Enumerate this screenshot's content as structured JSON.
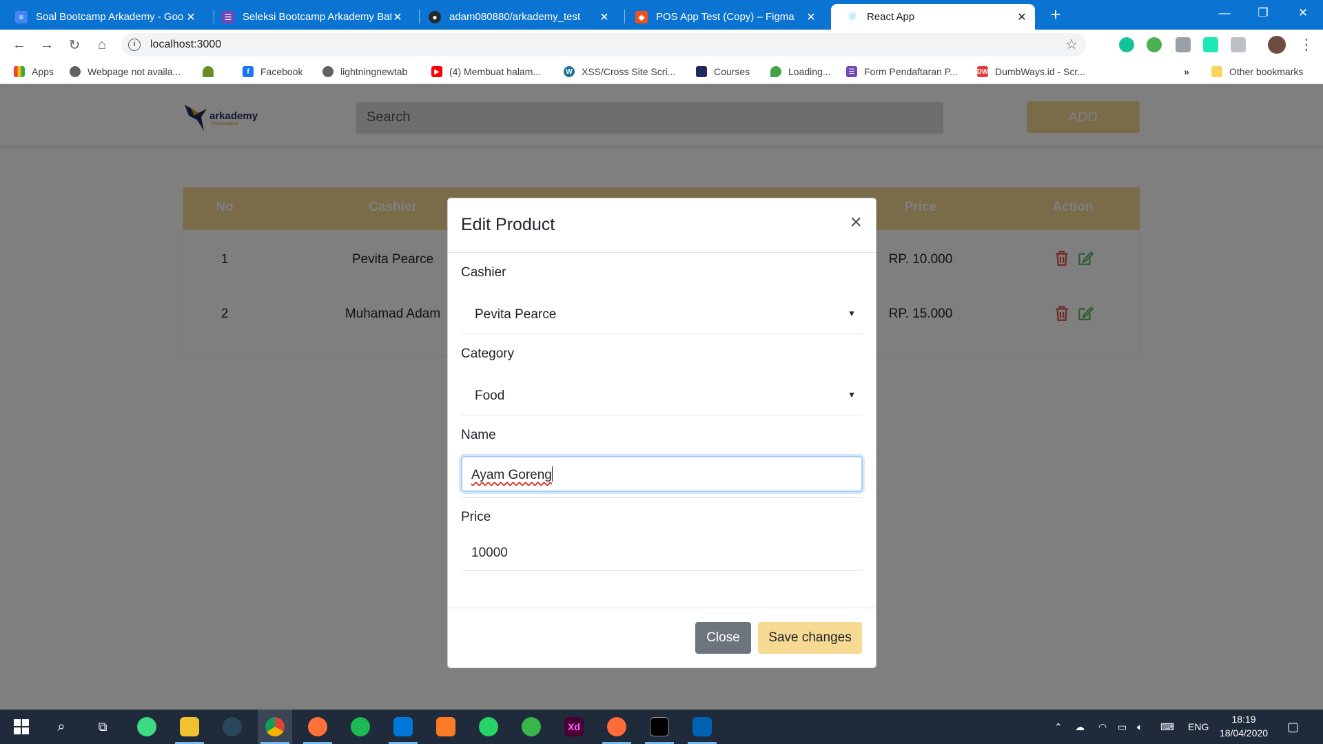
{
  "browser": {
    "tabs": [
      {
        "title": "Soal Bootcamp Arkademy - Goo",
        "icon": "google-docs-icon",
        "color": "#4285f4"
      },
      {
        "title": "Seleksi Bootcamp Arkademy Batc",
        "icon": "google-forms-icon",
        "color": "#7248b9"
      },
      {
        "title": "adam080880/arkademy_test",
        "icon": "github-icon",
        "color": "#24292e"
      },
      {
        "title": "POS App Test (Copy) – Figma",
        "icon": "figma-icon",
        "color": "#f24e1e"
      },
      {
        "title": "React App",
        "icon": "react-icon",
        "color": "#61dafb"
      }
    ],
    "url": "localhost:3000",
    "bookmarks": [
      {
        "label": "Apps",
        "icon": "apps-grid-icon"
      },
      {
        "label": "Webpage not availa...",
        "icon": "globe-icon"
      },
      {
        "label": "",
        "icon": "bird-icon"
      },
      {
        "label": "Facebook",
        "icon": "facebook-icon"
      },
      {
        "label": "lightningnewtab",
        "icon": "globe-icon"
      },
      {
        "label": "(4) Membuat halam...",
        "icon": "youtube-icon"
      },
      {
        "label": "XSS/Cross Site Scri...",
        "icon": "wordpress-icon"
      },
      {
        "label": "Courses",
        "icon": "arkademy-icon"
      },
      {
        "label": "Loading...",
        "icon": "leaf-icon"
      },
      {
        "label": "Form Pendaftaran P...",
        "icon": "google-forms-icon"
      },
      {
        "label": "DumbWays.id - Scr...",
        "icon": "dumbways-icon"
      }
    ],
    "more_bookmarks": "»",
    "other_bookmarks": "Other bookmarks"
  },
  "page": {
    "logo_text": "arkademy",
    "logo_sub": "Tech Academy",
    "search_placeholder": "Search",
    "add_label": "ADD",
    "table": {
      "headers": [
        "No",
        "Cashier",
        "Price",
        "Action"
      ],
      "rows": [
        {
          "no": "1",
          "cashier": "Pevita Pearce",
          "price": "RP. 10.000"
        },
        {
          "no": "2",
          "cashier": "Muhamad Adam",
          "price": "RP. 15.000"
        }
      ]
    }
  },
  "modal": {
    "title": "Edit Product",
    "close_glyph": "×",
    "fields": {
      "cashier": {
        "label": "Cashier",
        "value": "Pevita Pearce"
      },
      "category": {
        "label": "Category",
        "value": "Food"
      },
      "name": {
        "label": "Name",
        "value": "Ayam Goreng"
      },
      "price": {
        "label": "Price",
        "value": "10000"
      }
    },
    "close_button": "Close",
    "save_button": "Save changes"
  },
  "taskbar": {
    "apps": [
      {
        "name": "android-studio-icon",
        "color": "#3ddc84"
      },
      {
        "name": "file-explorer-icon",
        "color": "#f2c12e"
      },
      {
        "name": "steam-icon",
        "color": "#2a475e"
      },
      {
        "name": "chrome-icon",
        "color": "#db4437",
        "active": true
      },
      {
        "name": "firefox-icon",
        "color": "#ff7139"
      },
      {
        "name": "spotify-icon",
        "color": "#1db954"
      },
      {
        "name": "vscode-icon",
        "color": "#0078d7"
      },
      {
        "name": "xampp-icon",
        "color": "#fb7a24"
      },
      {
        "name": "whatsapp-icon",
        "color": "#25d366"
      },
      {
        "name": "inkscape-icon",
        "color": "#3ab54a"
      },
      {
        "name": "adobe-xd-icon",
        "color": "#470137"
      },
      {
        "name": "postman-icon",
        "color": "#ff6c37"
      },
      {
        "name": "terminal-icon",
        "color": "#000000"
      },
      {
        "name": "photos-icon",
        "color": "#0063b1"
      }
    ],
    "language": "ENG",
    "time": "18:19",
    "date": "18/04/2020"
  },
  "colors": {
    "accent": "#f6d992",
    "chrome_blue": "#0b73d1",
    "delete": "#d9534f",
    "edit": "#5cb85c"
  }
}
